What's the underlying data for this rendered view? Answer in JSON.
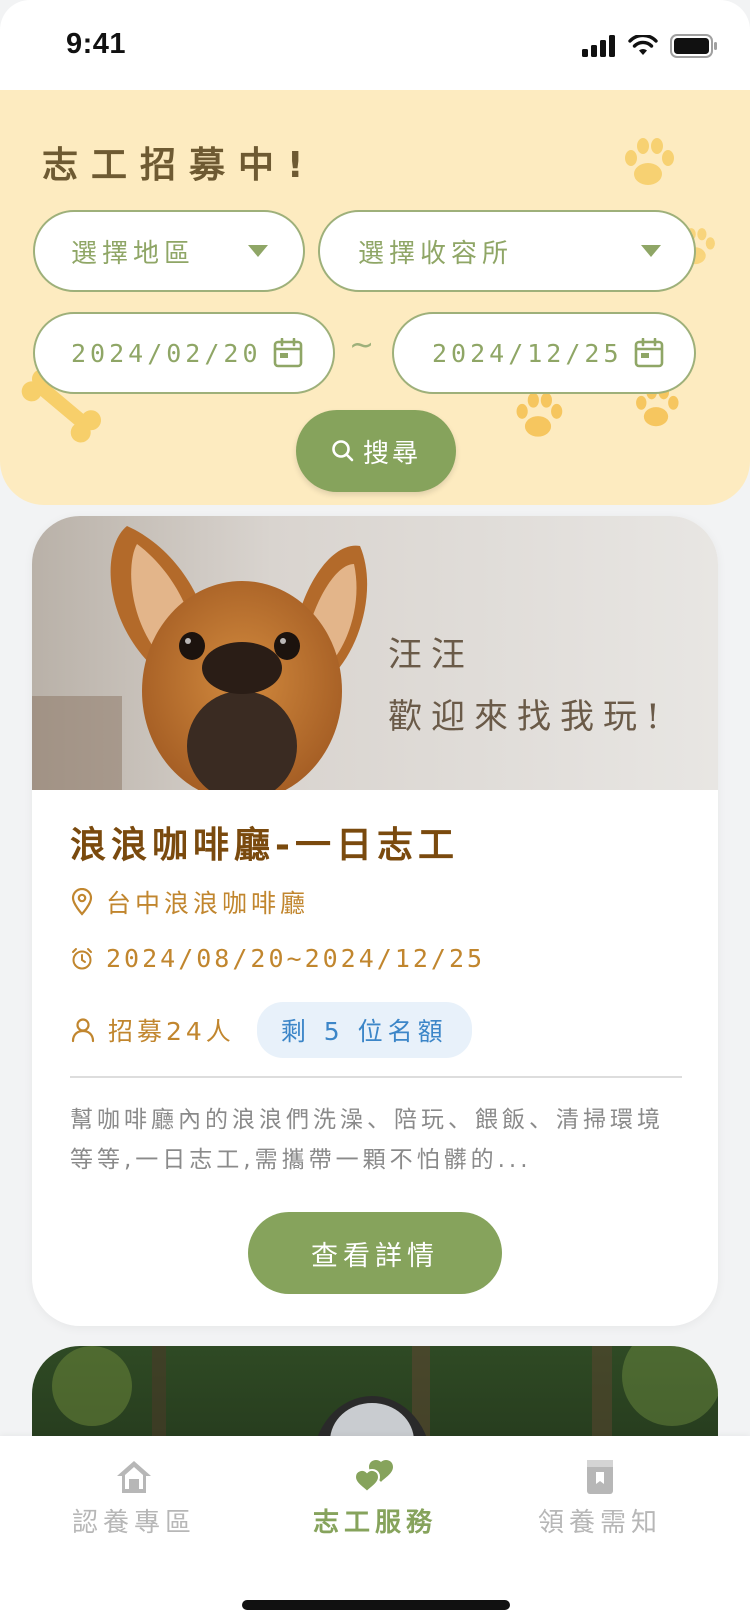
{
  "status_bar": {
    "time": "9:41"
  },
  "filter": {
    "title": "志工招募中!",
    "region_placeholder": "選擇地區",
    "shelter_placeholder": "選擇收容所",
    "date_start": "2024/02/20",
    "date_separator": "~",
    "date_end": "2024/12/25",
    "search_label": "搜尋"
  },
  "card": {
    "hero_line1": "汪汪",
    "hero_line2": "歡迎來找我玩!",
    "title": "浪浪咖啡廳-一日志工",
    "place": "台中浪浪咖啡廳",
    "date_range": "2024/08/20~2024/12/25",
    "recruit_count": "招募24人",
    "quota_left": "剩 5 位名額",
    "description": "幫咖啡廳內的浪浪們洗澡、陪玩、餵飯、清掃環境等等,一日志工,需攜帶一顆不怕髒的...",
    "detail_label": "查看詳情"
  },
  "bottom_nav": {
    "items": [
      {
        "label": "認養專區",
        "icon": "house-icon",
        "active": false
      },
      {
        "label": "志工服務",
        "icon": "hearts-icon",
        "active": true
      },
      {
        "label": "領養需知",
        "icon": "book-icon",
        "active": false
      }
    ]
  },
  "colors": {
    "accent_green": "#86a35c",
    "panel_yellow": "#fdebc0",
    "title_brown": "#7a4a0e",
    "info_gold": "#c1862e",
    "badge_blue": "#3c86c8"
  }
}
